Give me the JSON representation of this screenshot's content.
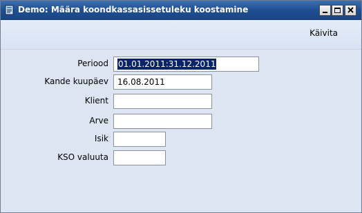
{
  "window": {
    "title": "Demo: Määra koondkassasissetuleku koostamine",
    "icon": "document-app-icon",
    "controls": [
      "minimize-icon",
      "maximize-icon",
      "close-icon"
    ]
  },
  "toolbar": {
    "run_label": "Käivita"
  },
  "form": {
    "period": {
      "label": "Periood",
      "value": "01.01.2011:31.12.2011"
    },
    "date": {
      "label": "Kande kuupäev",
      "value": "16.08.2011"
    },
    "client": {
      "label": "Klient",
      "value": ""
    },
    "invoice": {
      "label": "Arve",
      "value": ""
    },
    "person": {
      "label": "Isik",
      "value": ""
    },
    "currency": {
      "label": "KSO valuuta",
      "value": ""
    }
  },
  "colors": {
    "titlebar": "#1f4f92",
    "background": "#dde5f2",
    "selection": "#0a246a"
  }
}
